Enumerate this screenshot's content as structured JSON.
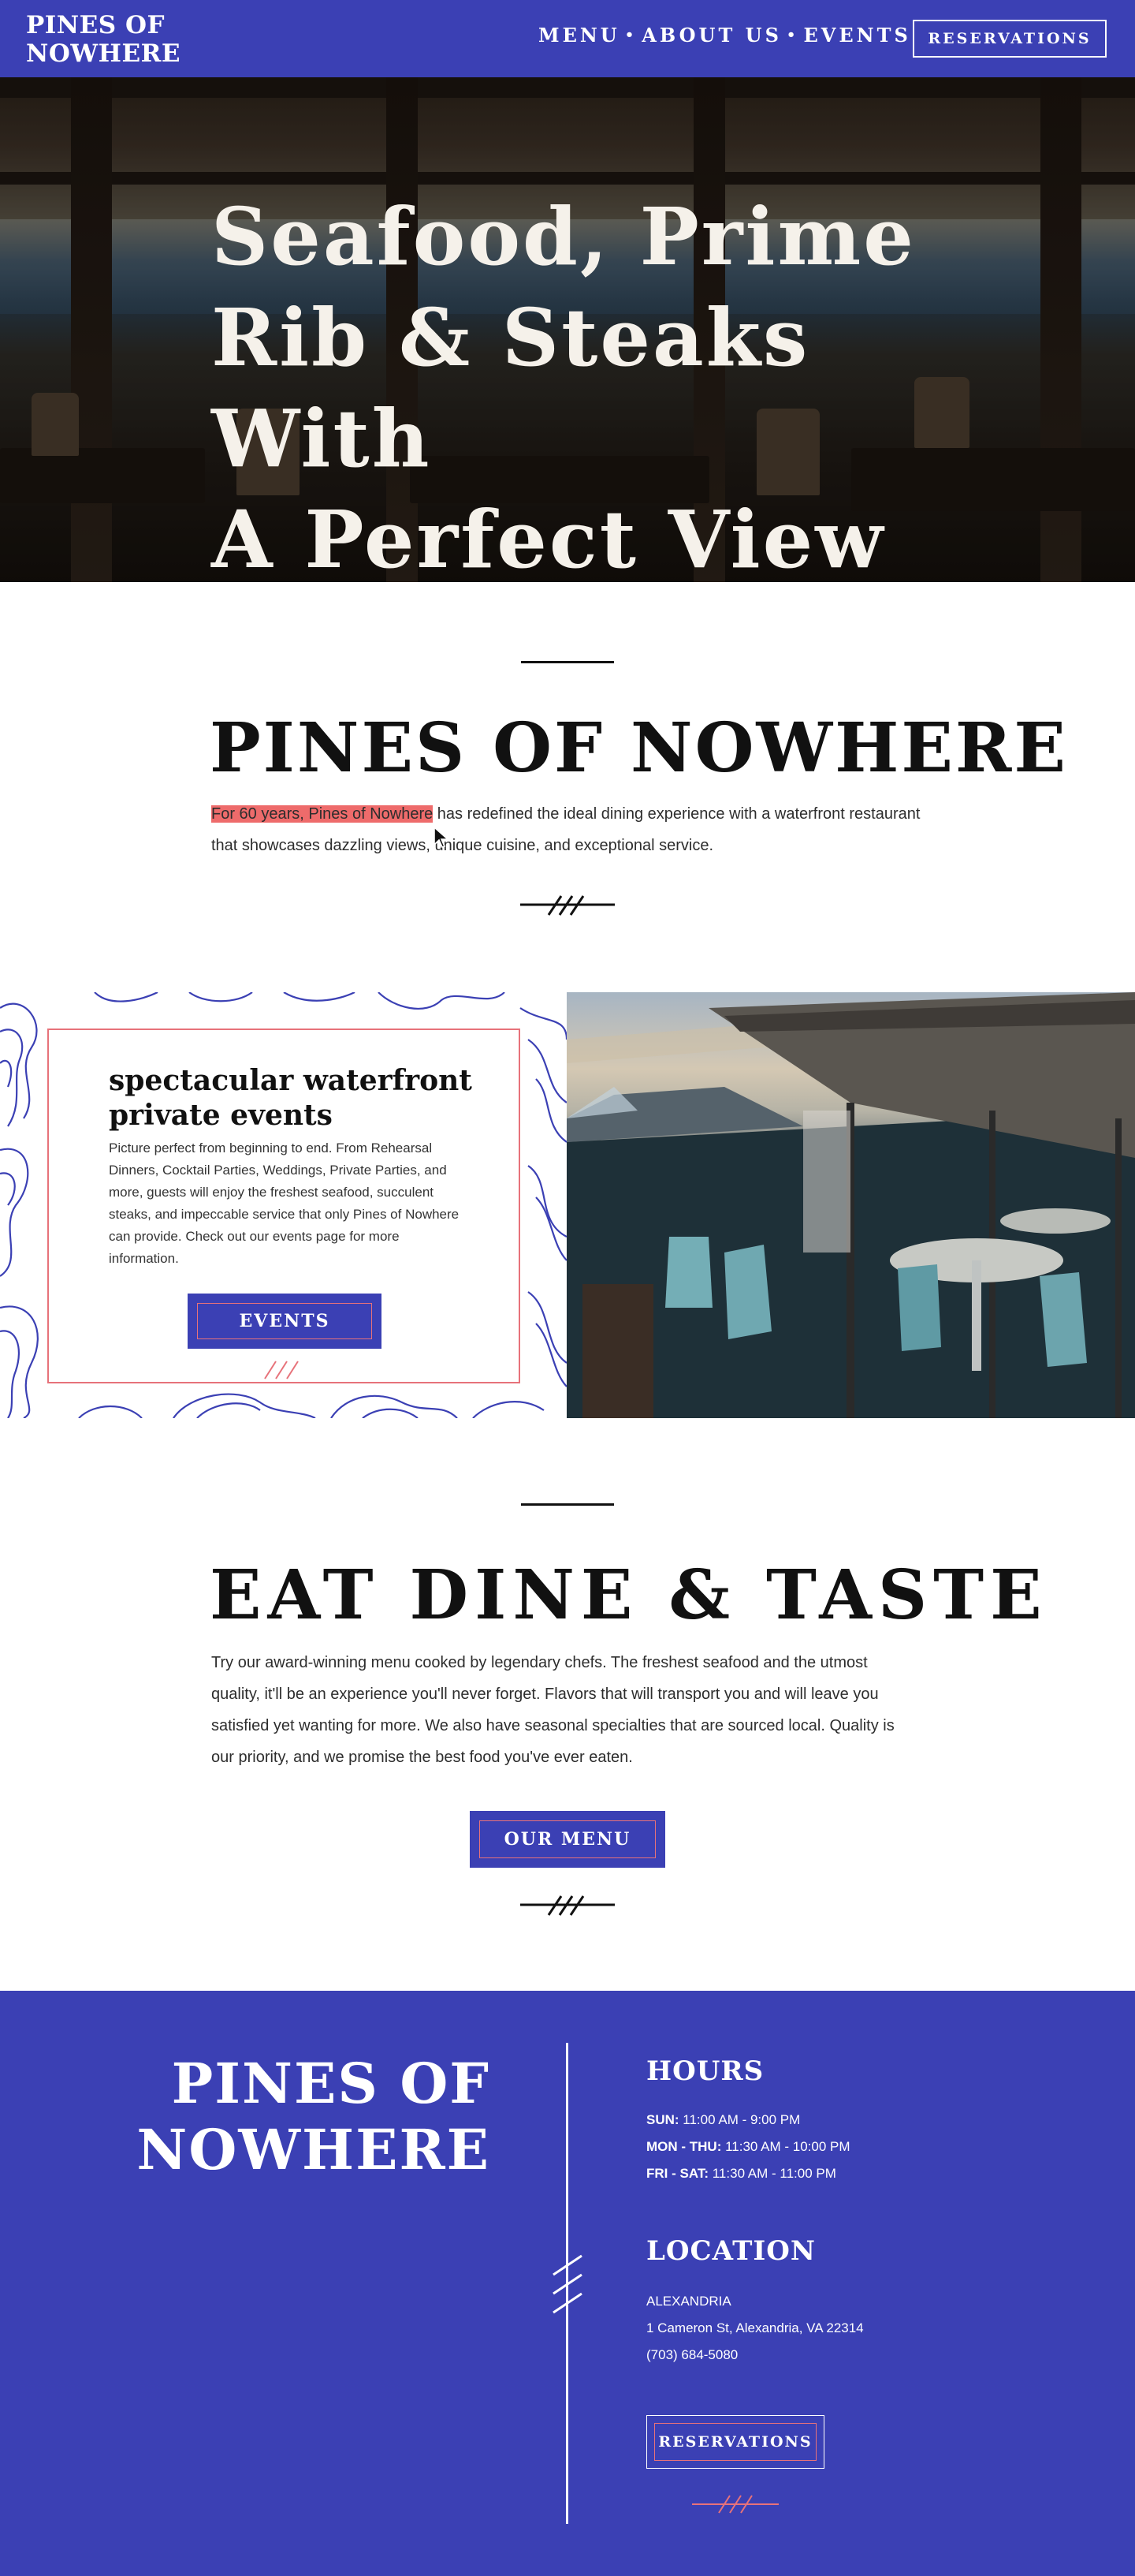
{
  "brand": {
    "name_line1": "PINES OF",
    "name_line2": "NOWHERE"
  },
  "nav": {
    "links": [
      "MENU",
      "ABOUT US",
      "EVENTS"
    ],
    "separator": "•",
    "reservations_label": "RESERVATIONS"
  },
  "hero": {
    "line1": "Seafood, Prime",
    "line2": "Rib & Steaks With",
    "line3": "A Perfect View"
  },
  "about": {
    "title": "PINES OF NOWHERE",
    "highlighted": "For 60 years, Pines of Nowhere",
    "rest": " has redefined the ideal dining experience with a waterfront restaurant that showcases dazzling views, unique cuisine, and exceptional service."
  },
  "events": {
    "title": "spectacular waterfront private events",
    "body": "Picture perfect from beginning to end. From Rehearsal Dinners, Cocktail Parties, Weddings, Private Parties, and more, guests will enjoy the freshest seafood, succulent steaks, and impeccable service that only Pines of Nowhere can provide. Check out our events page for more information.",
    "button_label": "EVENTS"
  },
  "eat": {
    "title": "EAT DINE & TASTE",
    "body": "Try our award-winning menu cooked by legendary chefs. The freshest seafood and the utmost quality, it'll be an experience you'll never forget. Flavors that will transport you and will leave you satisfied yet wanting for more. We also have seasonal specialties that are sourced local. Quality is our priority, and we promise the best food you've ever eaten.",
    "button_label": "OUR MENU"
  },
  "footer": {
    "brand_line1": "PINES OF",
    "brand_line2": "NOWHERE",
    "hours_title": "HOURS",
    "hours": [
      {
        "days": "SUN:",
        "time": " 11:00 AM - 9:00 PM"
      },
      {
        "days": "MON - THU:",
        "time": " 11:30 AM - 10:00 PM"
      },
      {
        "days": "FRI - SAT:",
        "time": " 11:30 AM - 11:00 PM"
      }
    ],
    "location_title": "LOCATION",
    "city": "ALEXANDRIA",
    "address": "1 Cameron St, Alexandria, VA 22314",
    "phone": "(703) 684-5080",
    "reservations_label": "RESERVATIONS"
  },
  "colors": {
    "primary": "#3b40b4",
    "accent": "#e7727a",
    "highlight": "#ee6b6b",
    "text": "#1c1c1c"
  },
  "icons": [
    "mouse-pointer-icon",
    "triple-slash-icon"
  ]
}
